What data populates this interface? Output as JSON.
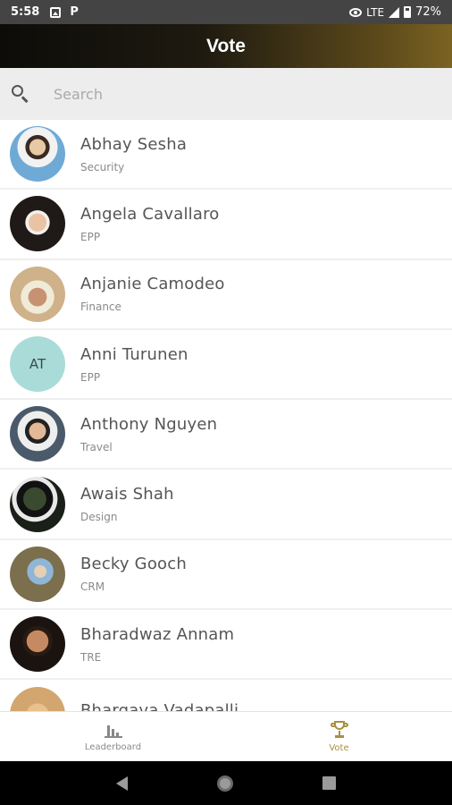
{
  "status_bar": {
    "time": "5:58",
    "p_label": "P",
    "network": "LTE",
    "battery": "72%"
  },
  "app_bar": {
    "title": "Vote"
  },
  "search": {
    "placeholder": "Search",
    "value": ""
  },
  "people": [
    {
      "name": "Abhay Sesha",
      "department": "Security",
      "avatar": {
        "type": "photo",
        "color": "#5b9fcf"
      }
    },
    {
      "name": "Angela Cavallaro",
      "department": "EPP",
      "avatar": {
        "type": "photo",
        "color": "#2a2020"
      }
    },
    {
      "name": "Anjanie Camodeo",
      "department": "Finance",
      "avatar": {
        "type": "photo",
        "color": "#b9a98a"
      }
    },
    {
      "name": "Anni Turunen",
      "department": "EPP",
      "avatar": {
        "type": "initials",
        "initials": "AT",
        "color": "#a9dcd8"
      }
    },
    {
      "name": "Anthony Nguyen",
      "department": "Travel",
      "avatar": {
        "type": "photo",
        "color": "#dcdcdc"
      }
    },
    {
      "name": "Awais Shah",
      "department": "Design",
      "avatar": {
        "type": "photo",
        "color": "#1f2a1c"
      }
    },
    {
      "name": "Becky Gooch",
      "department": "CRM",
      "avatar": {
        "type": "photo",
        "color": "#8c7e5c"
      }
    },
    {
      "name": "Bharadwaz Annam",
      "department": "TRE",
      "avatar": {
        "type": "photo",
        "color": "#3b2418"
      }
    },
    {
      "name": "Bhargava Vadapalli",
      "department": "",
      "avatar": {
        "type": "photo",
        "color": "#d9b98c"
      }
    }
  ],
  "bottom_nav": {
    "items": [
      {
        "label": "Leaderboard",
        "icon": "bar-chart-icon",
        "active": false
      },
      {
        "label": "Vote",
        "icon": "trophy-icon",
        "active": true
      }
    ],
    "active_color": "#a89040"
  },
  "colors": {
    "appbar_gradient_start": "#0d0c09",
    "appbar_gradient_end": "#7a6322",
    "search_bg": "#ededed"
  }
}
